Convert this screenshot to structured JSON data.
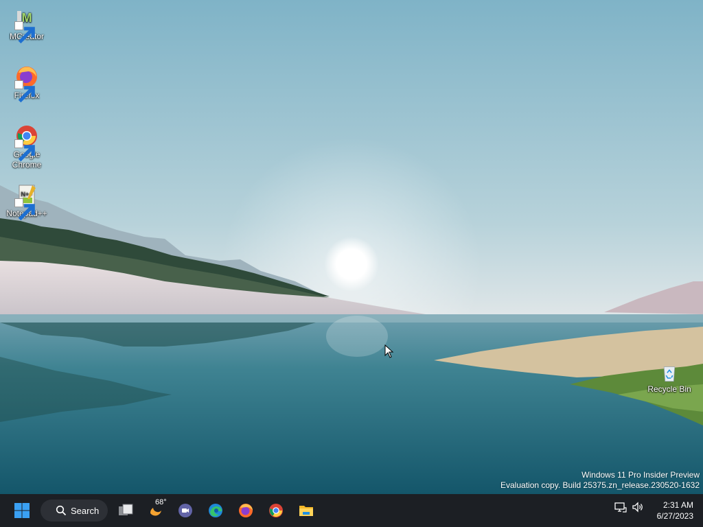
{
  "desktop_icons": [
    {
      "name": "MCreator",
      "icon": "mcreator-icon",
      "shortcut": true
    },
    {
      "name": "Firefox",
      "icon": "firefox-icon",
      "shortcut": true
    },
    {
      "name": "Google Chrome",
      "icon": "chrome-icon",
      "shortcut": true
    },
    {
      "name": "Notepad++",
      "icon": "notepadplusplus-icon",
      "shortcut": true
    },
    {
      "name": "Recycle Bin",
      "icon": "recycle-bin-icon",
      "shortcut": false
    }
  ],
  "watermark": {
    "line1": "Windows 11 Pro Insider Preview",
    "line2": "Evaluation copy. Build 25375.zn_release.230520-1632"
  },
  "taskbar": {
    "search_label": "Search",
    "weather_temp": "68°",
    "apps": [
      "start-icon",
      "task-view-icon",
      "weather-icon",
      "teams-chat-icon",
      "edge-icon",
      "firefox-icon",
      "chrome-icon",
      "file-explorer-icon"
    ],
    "tray_icons": [
      "network-icon",
      "volume-icon"
    ],
    "clock_time": "2:31 AM",
    "clock_date": "6/27/2023"
  },
  "colors": {
    "taskbar_bg": "#1c1f24",
    "start_blue": "#3aa0f3"
  }
}
